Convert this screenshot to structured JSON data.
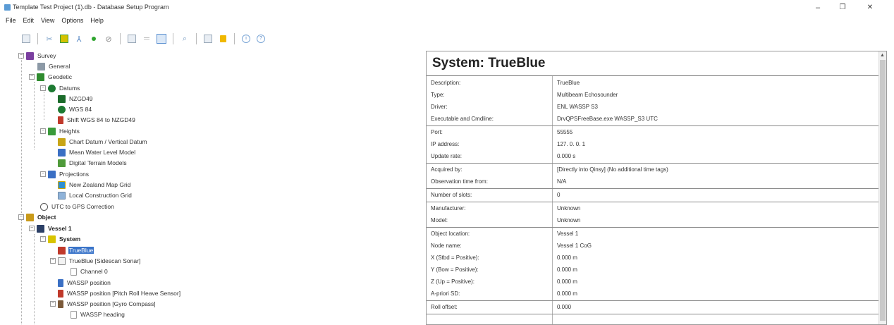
{
  "window": {
    "title": "Template Test Project (1).db - Database Setup Program",
    "minimize_glyph": "–",
    "maximize_glyph": "❐",
    "close_glyph": "✕"
  },
  "menu": [
    "File",
    "Edit",
    "View",
    "Options",
    "Help"
  ],
  "toolbar": {
    "icons": [
      "list-icon",
      "split-icon",
      "object-icon",
      "antenna-icon",
      "dot-icon",
      "link-icon",
      "panel-icon",
      "line-icon",
      "edit-icon",
      "search-icon",
      "image-icon",
      "lock-icon",
      "info-icon",
      "help-icon"
    ],
    "info_glyph": "i",
    "help_glyph": "?"
  },
  "tree": {
    "expand_glyph": "−",
    "collapse_glyph": "+",
    "survey": "Survey",
    "general": "General",
    "geodetic": "Geodetic",
    "datums": "Datums",
    "nzgd49": "NZGD49",
    "wgs84": "WGS 84",
    "shift": "Shift WGS 84 to NZGD49",
    "heights": "Heights",
    "chart_datum": "Chart Datum / Vertical Datum",
    "mean_water": "Mean Water Level Model",
    "digital_terrain": "Digital Terrain Models",
    "projections": "Projections",
    "nz_map_grid": "New Zealand Map Grid",
    "local_grid": "Local Construction Grid",
    "utc_gps": "UTC to GPS Correction",
    "object": "Object",
    "vessel1": "Vessel 1",
    "system": "System",
    "trueblue": "TrueBlue",
    "trueblue_sidescan": "TrueBlue  [Sidescan Sonar]",
    "channel0": "Channel 0",
    "wassp_position": "WASSP position",
    "wassp_prh": "WASSP position  [Pitch Roll Heave Sensor]",
    "wassp_gyro": "WASSP position [Gyro Compass]",
    "wassp_heading": "WASSP heading"
  },
  "panel": {
    "title": "System: TrueBlue",
    "scroll_up_glyph": "▲",
    "groups": [
      [
        {
          "key": "Description:",
          "value": "TrueBlue"
        },
        {
          "key": "Type:",
          "value": "Multibeam Echosounder"
        },
        {
          "key": "Driver:",
          "value": "ENL WASSP S3"
        },
        {
          "key": "Executable and Cmdline:",
          "value": "DrvQPSFreeBase.exe WASSP_S3 UTC"
        }
      ],
      [
        {
          "key": "Port:",
          "value": "55555"
        },
        {
          "key": "IP address:",
          "value": "127.  0.  0.  1"
        },
        {
          "key": "Update rate:",
          "value": "0.000 s"
        }
      ],
      [
        {
          "key": "Acquired by:",
          "value": "[Directly into Qinsy] (No additional time tags)"
        },
        {
          "key": "Observation time from:",
          "value": "N/A"
        }
      ],
      [
        {
          "key": "Number of slots:",
          "value": "0"
        }
      ],
      [
        {
          "key": "Manufacturer:",
          "value": "Unknown"
        },
        {
          "key": "Model:",
          "value": "Unknown"
        }
      ],
      [
        {
          "key": "Object location:",
          "value": "Vessel 1"
        },
        {
          "key": "Node name:",
          "value": "Vessel 1 CoG"
        },
        {
          "key": "X  (Stbd = Positive):",
          "value": "0.000 m"
        },
        {
          "key": "Y  (Bow = Positive):",
          "value": "0.000 m"
        },
        {
          "key": "Z  (Up = Positive):",
          "value": "0.000 m"
        },
        {
          "key": "A-priori SD:",
          "value": "0.000 m"
        }
      ],
      [
        {
          "key": "Roll offset:",
          "value": "0.000"
        }
      ]
    ]
  },
  "colors": {
    "selection": "#3a74c9",
    "survey_icon": "#7b3fa0",
    "green_icon": "#2e8b2e",
    "blue_icon": "#3a6fc4",
    "red_icon": "#c0392b"
  }
}
